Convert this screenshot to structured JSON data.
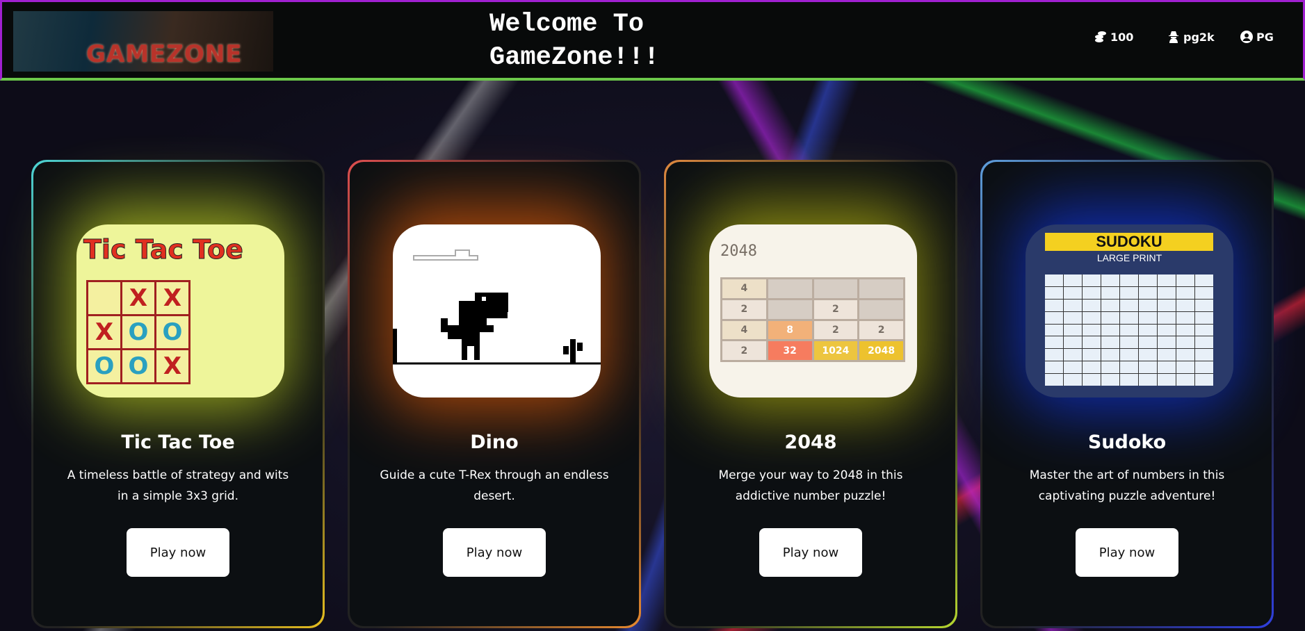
{
  "header": {
    "logo_text": "GAMEZONE",
    "title_line1": "Welcome To",
    "title_line2": "GameZone!!!",
    "coins": {
      "icon": "coins-icon",
      "value": "100"
    },
    "username": {
      "icon": "user-secret-icon",
      "value": "pg2k"
    },
    "profile": {
      "icon": "user-circle-icon",
      "value": "PG"
    }
  },
  "games": [
    {
      "title": "Tic Tac Toe",
      "description": "A timeless battle of strategy and wits in a simple 3x3 grid.",
      "button": "Play now",
      "border": [
        "#4fd8d8",
        "#e8c020"
      ],
      "glow": "#a8b820",
      "thumb": {
        "heading": "Tic Tac Toe",
        "cells": [
          "",
          "X",
          "X",
          "X",
          "O",
          "O",
          "O",
          "O",
          "X"
        ]
      }
    },
    {
      "title": "Dino",
      "description": "Guide a cute T-Rex through an endless desert.",
      "button": "Play now",
      "border": [
        "#e05050",
        "#e88a30"
      ],
      "glow": "#c0500a"
    },
    {
      "title": "2048",
      "description": "Merge your way to 2048 in this addictive number puzzle!",
      "button": "Play now",
      "border": [
        "#e08a40",
        "#b8d830"
      ],
      "glow": "#9a9a10",
      "thumb": {
        "heading": "2048",
        "tiles": [
          "4",
          "",
          "",
          "",
          "2",
          "",
          "2",
          "",
          "4",
          "8",
          "2",
          "2",
          "2",
          "32",
          "1024",
          "2048"
        ]
      }
    },
    {
      "title": "Sudoko",
      "description": "Master the art of numbers in this captivating puzzle adventure!",
      "button": "Play now",
      "border": [
        "#60a0e0",
        "#3040e0"
      ],
      "glow": "#1030c0",
      "thumb": {
        "heading": "SUDOKU",
        "subheading": "LARGE PRINT"
      }
    }
  ]
}
